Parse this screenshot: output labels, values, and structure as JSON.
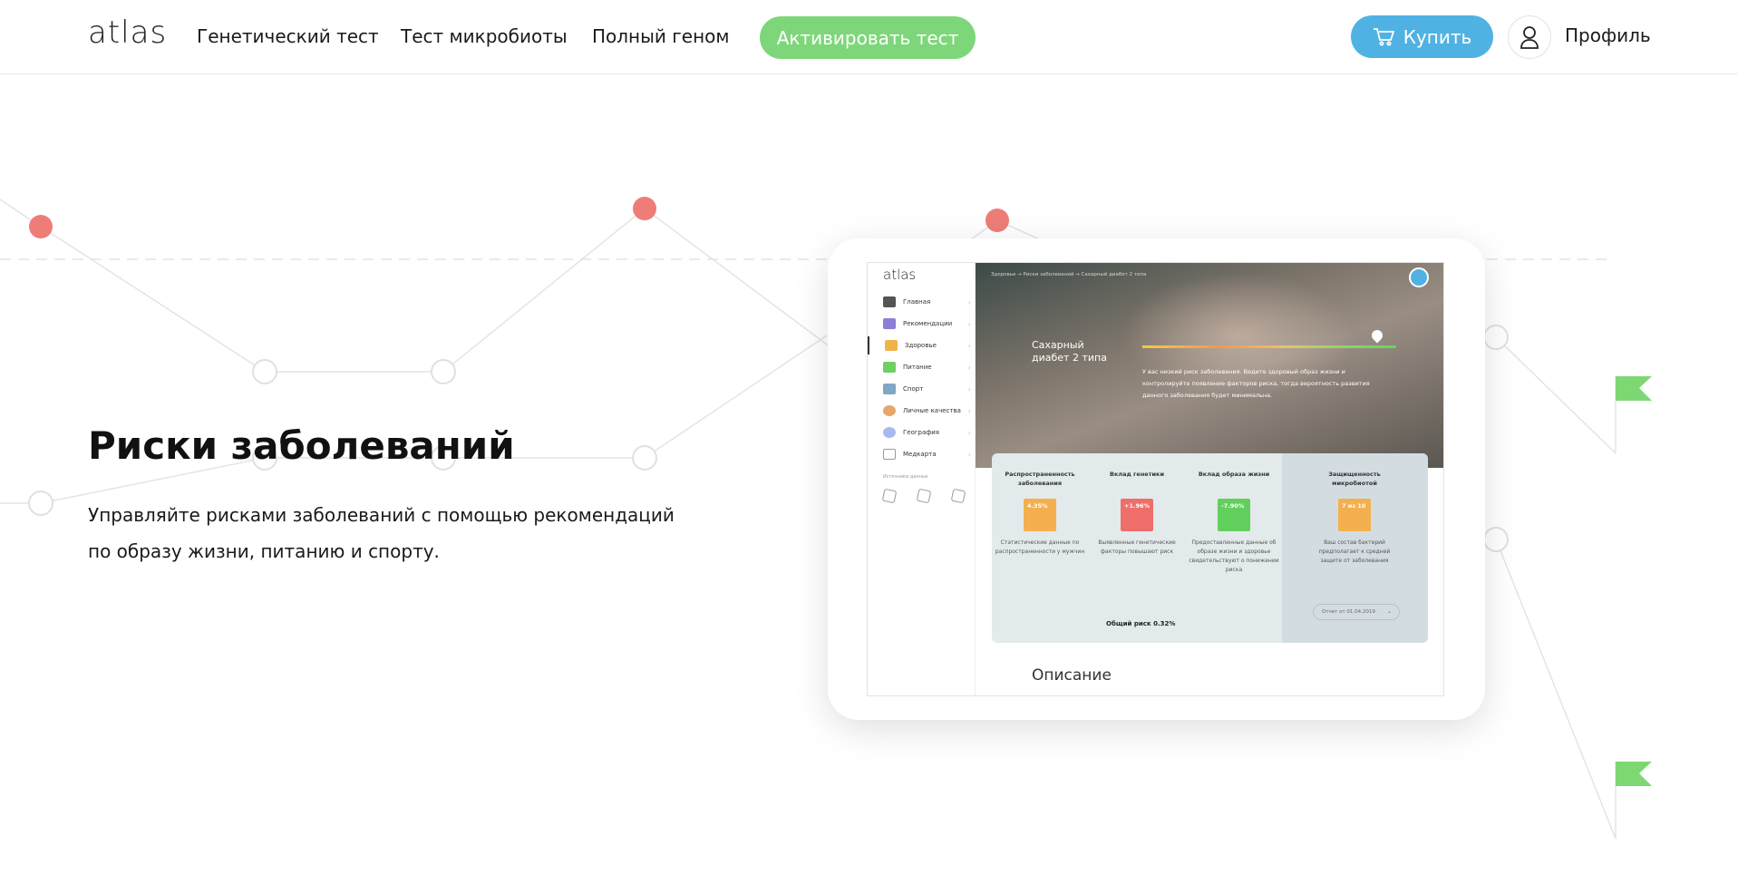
{
  "header": {
    "logo": "atlas",
    "nav": [
      "Генетический тест",
      "Тест микробиоты",
      "Полный геном"
    ],
    "activate_label": "Активировать тест",
    "buy_label": "Купить",
    "profile_label": "Профиль"
  },
  "hero": {
    "title": "Риски заболеваний",
    "description": "Управляйте рисками заболеваний с помощью рекомендаций по образу жизни, питанию и спорту."
  },
  "tablet": {
    "logo": "atlas",
    "sidebar": [
      "Главная",
      "Рекомендации",
      "Здоровье",
      "Питание",
      "Спорт",
      "Личные качества",
      "География",
      "Медкарта"
    ],
    "sidebar_active": "Здоровье",
    "data_sources_label": "Источники данных",
    "breadcrumbs": "Здоровье  →  Риски заболеваний  →  Сахарный диабет 2 типа",
    "disease_title": "Сахарный диабет 2 типа",
    "risk_text": "У вас низкий риск заболевания. Ведите здоровый образ жизни и контролируйте появление факторов риска, тогда вероятность развития данного заболевания будет минимальна.",
    "columns": [
      {
        "heading": "Распространенность заболевания",
        "value": "4.35%",
        "color": "#f4b04f",
        "note": "Статистические данные по распространенности у мужчин"
      },
      {
        "heading": "Вклад генетики",
        "value": "+1.96%",
        "color": "#ee6f6a",
        "note": "Выявленные генетические факторы повышают риск"
      },
      {
        "heading": "Вклад образа жизни",
        "value": "-7.90%",
        "color": "#62d05c",
        "note": "Предоставленные данные об образе жизни и здоровье свидетельствуют о понижении риска"
      },
      {
        "heading": "Защищенность микробиотой",
        "value": "7 из 10",
        "color": "#f4b04f",
        "note": "Ваш состав бактерий предполагает к средней защите от заболевания"
      }
    ],
    "total_risk": "Общий риск 0.32%",
    "report_select": "Отчет от 01.04.2019",
    "description_heading": "Описание"
  },
  "colors": {
    "activate": "#7ed67a",
    "buy": "#4fb2e3",
    "dot_red": "#ee7d78",
    "flag_green": "#7dd874"
  }
}
